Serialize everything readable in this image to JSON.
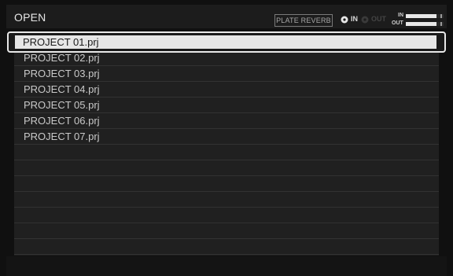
{
  "header": {
    "title": "OPEN",
    "effect_name": "PLATE REVERB",
    "in_label": "IN",
    "out_label": "OUT",
    "in_active": true,
    "out_active": false
  },
  "meters": {
    "in_label": "IN",
    "out_label": "OUT",
    "in_level": 0.82,
    "out_level": 0.82
  },
  "colors": {
    "background": "#101010",
    "row_text": "#c9c9c9",
    "selected_bg": "#e6e6e6",
    "selected_text": "#1a1a1a"
  },
  "files": [
    "PROJECT 01.prj",
    "PROJECT 02.prj",
    "PROJECT 03.prj",
    "PROJECT 04.prj",
    "PROJECT 05.prj",
    "PROJECT 06.prj",
    "PROJECT 07.prj"
  ],
  "selected_index": 0
}
